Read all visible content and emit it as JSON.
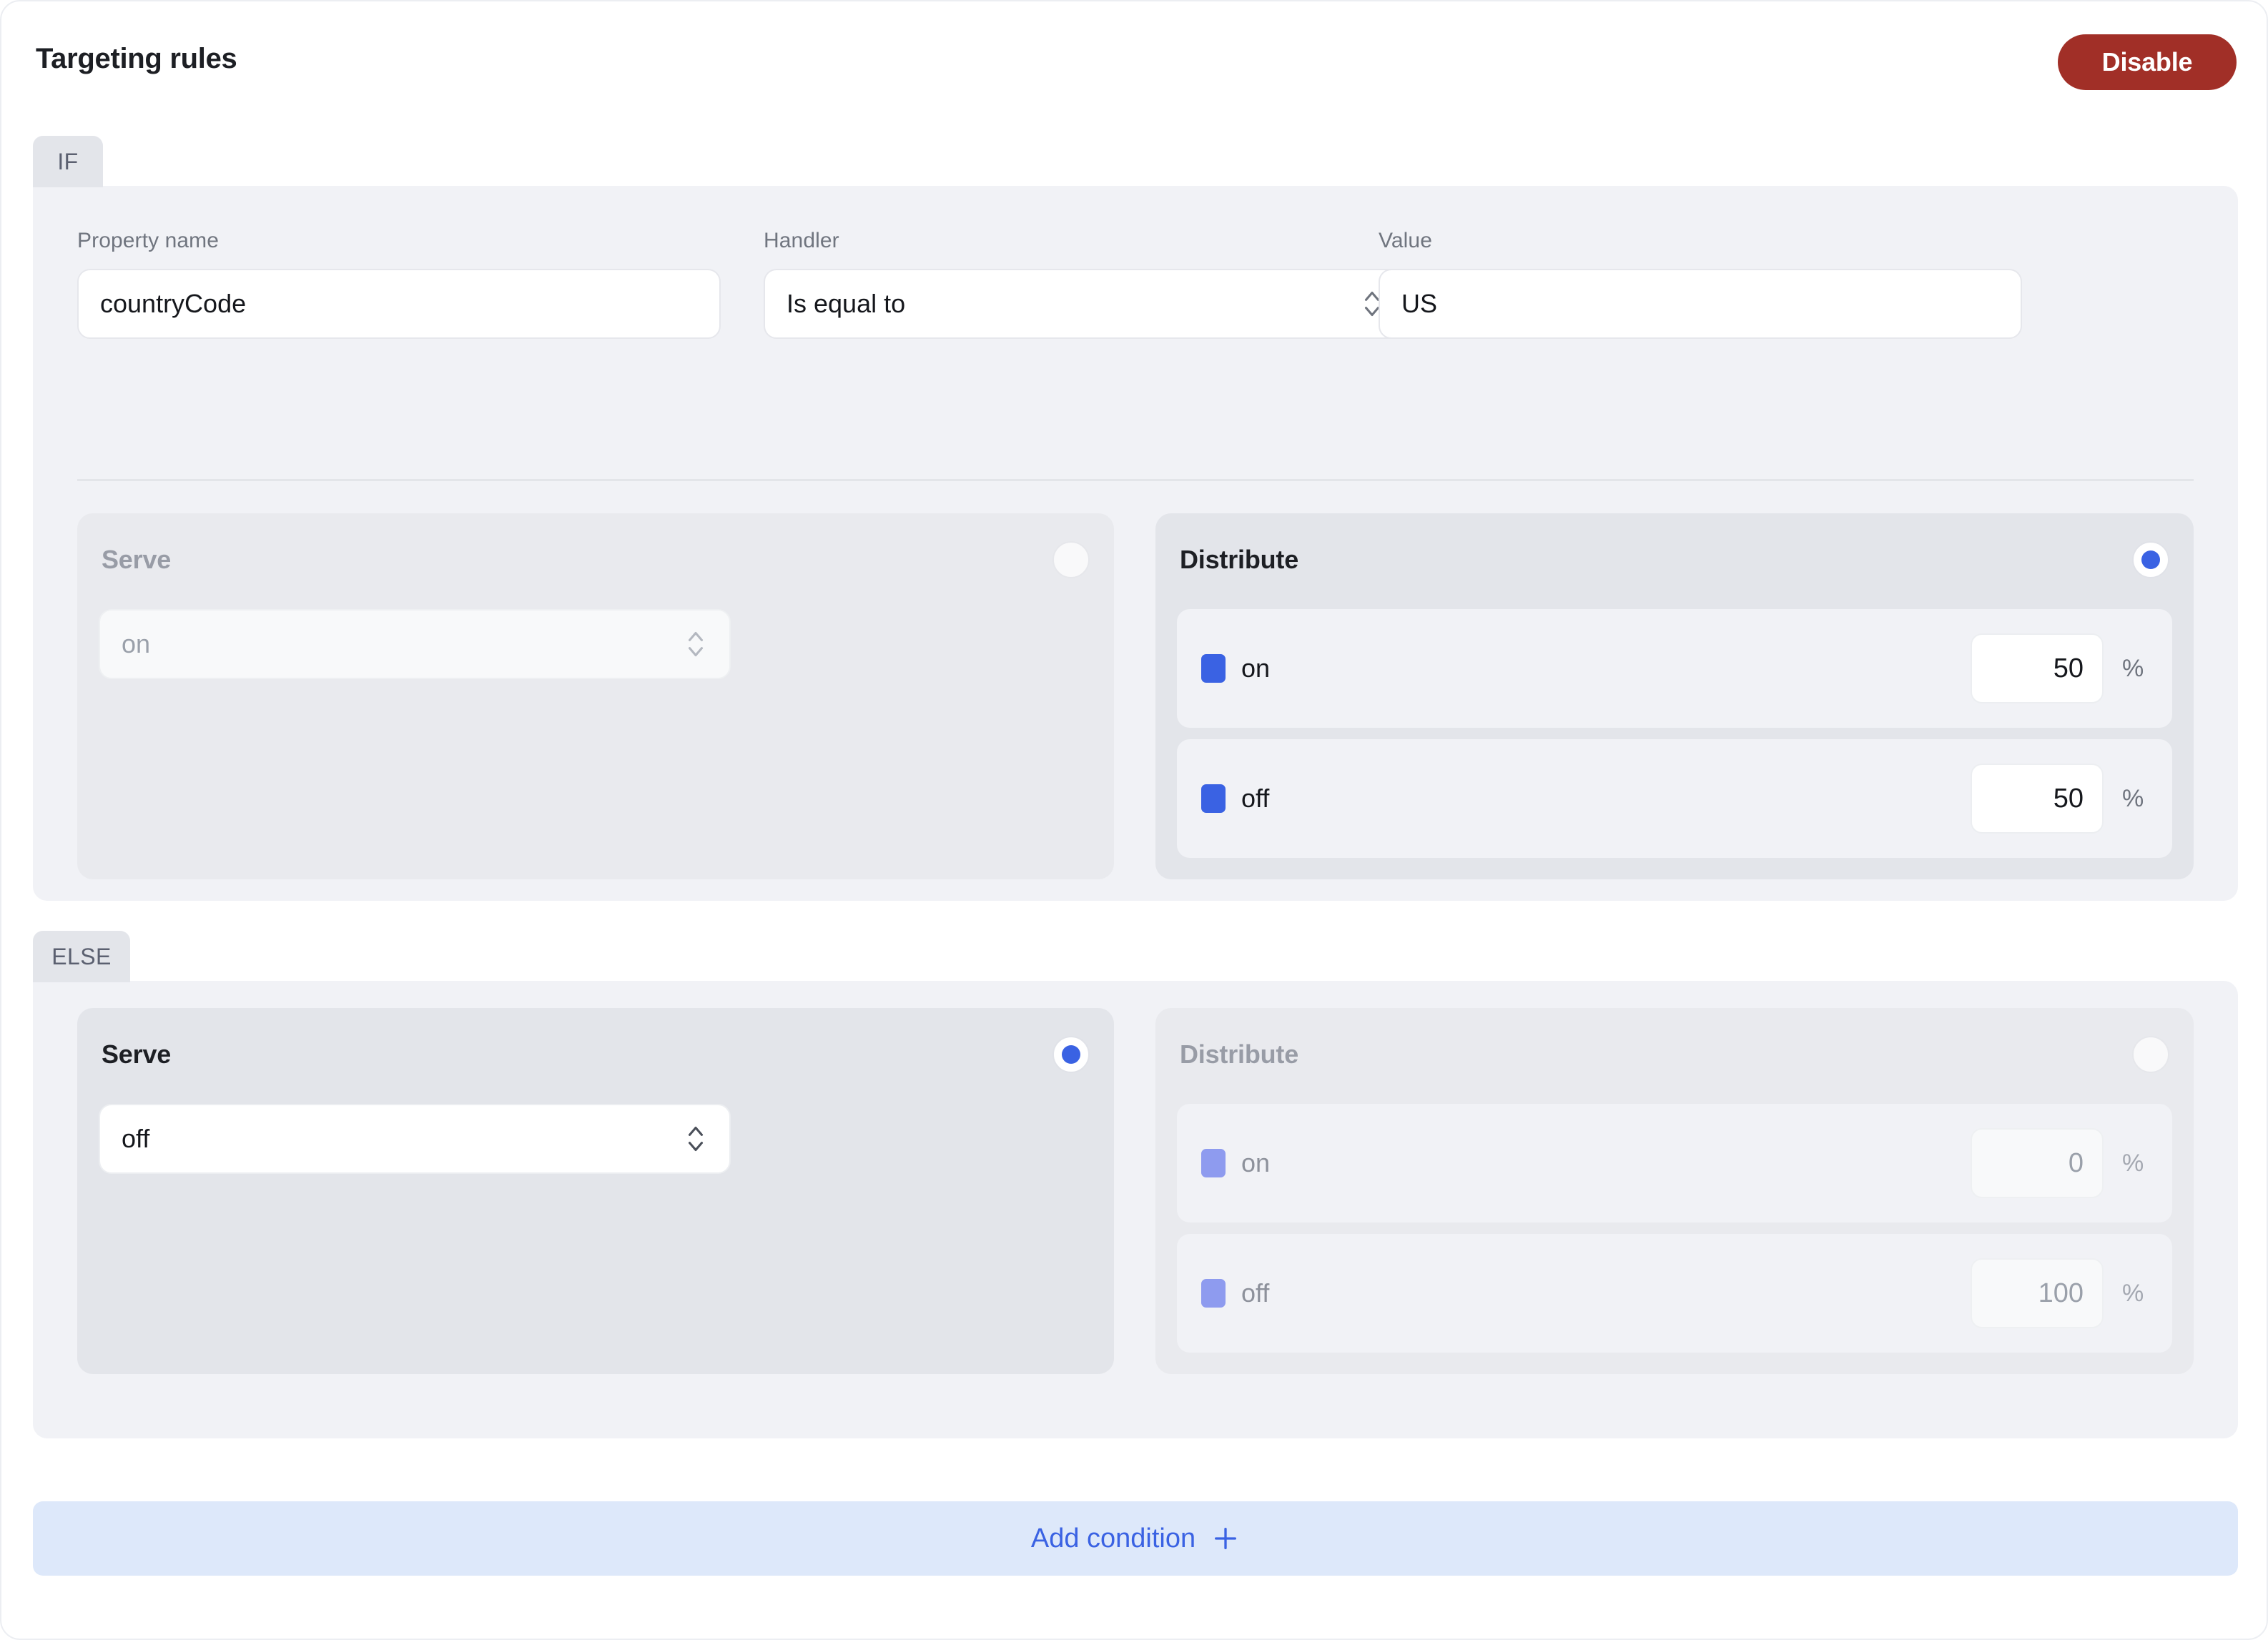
{
  "header": {
    "title": "Targeting rules",
    "disable_label": "Disable"
  },
  "labels": {
    "property_name": "Property name",
    "handler": "Handler",
    "value": "Value",
    "serve": "Serve",
    "distribute": "Distribute",
    "percent_sign": "%"
  },
  "if_block": {
    "tab_label": "IF",
    "condition": {
      "property_name": "countryCode",
      "handler": "Is equal to",
      "value": "US"
    },
    "serve": {
      "title": "Serve",
      "selected": false,
      "value": "on",
      "enabled": false
    },
    "distribute": {
      "title": "Distribute",
      "selected": true,
      "enabled": true,
      "rows": [
        {
          "label": "on",
          "percent": "50",
          "color": "#3a62e3"
        },
        {
          "label": "off",
          "percent": "50",
          "color": "#3a62e3"
        }
      ]
    }
  },
  "else_block": {
    "tab_label": "ELSE",
    "serve": {
      "title": "Serve",
      "selected": true,
      "value": "off",
      "enabled": true
    },
    "distribute": {
      "title": "Distribute",
      "selected": false,
      "enabled": false,
      "rows": [
        {
          "label": "on",
          "percent": "0",
          "color": "#8e9bef"
        },
        {
          "label": "off",
          "percent": "100",
          "color": "#8e9bef"
        }
      ]
    }
  },
  "footer": {
    "add_condition_label": "Add condition"
  },
  "colors": {
    "accent_blue": "#3a62e3",
    "danger_red": "#a12f27",
    "add_bar_bg": "#dde8fa",
    "panel_bg": "#e3e5ea",
    "block_bg": "#f1f2f6"
  }
}
